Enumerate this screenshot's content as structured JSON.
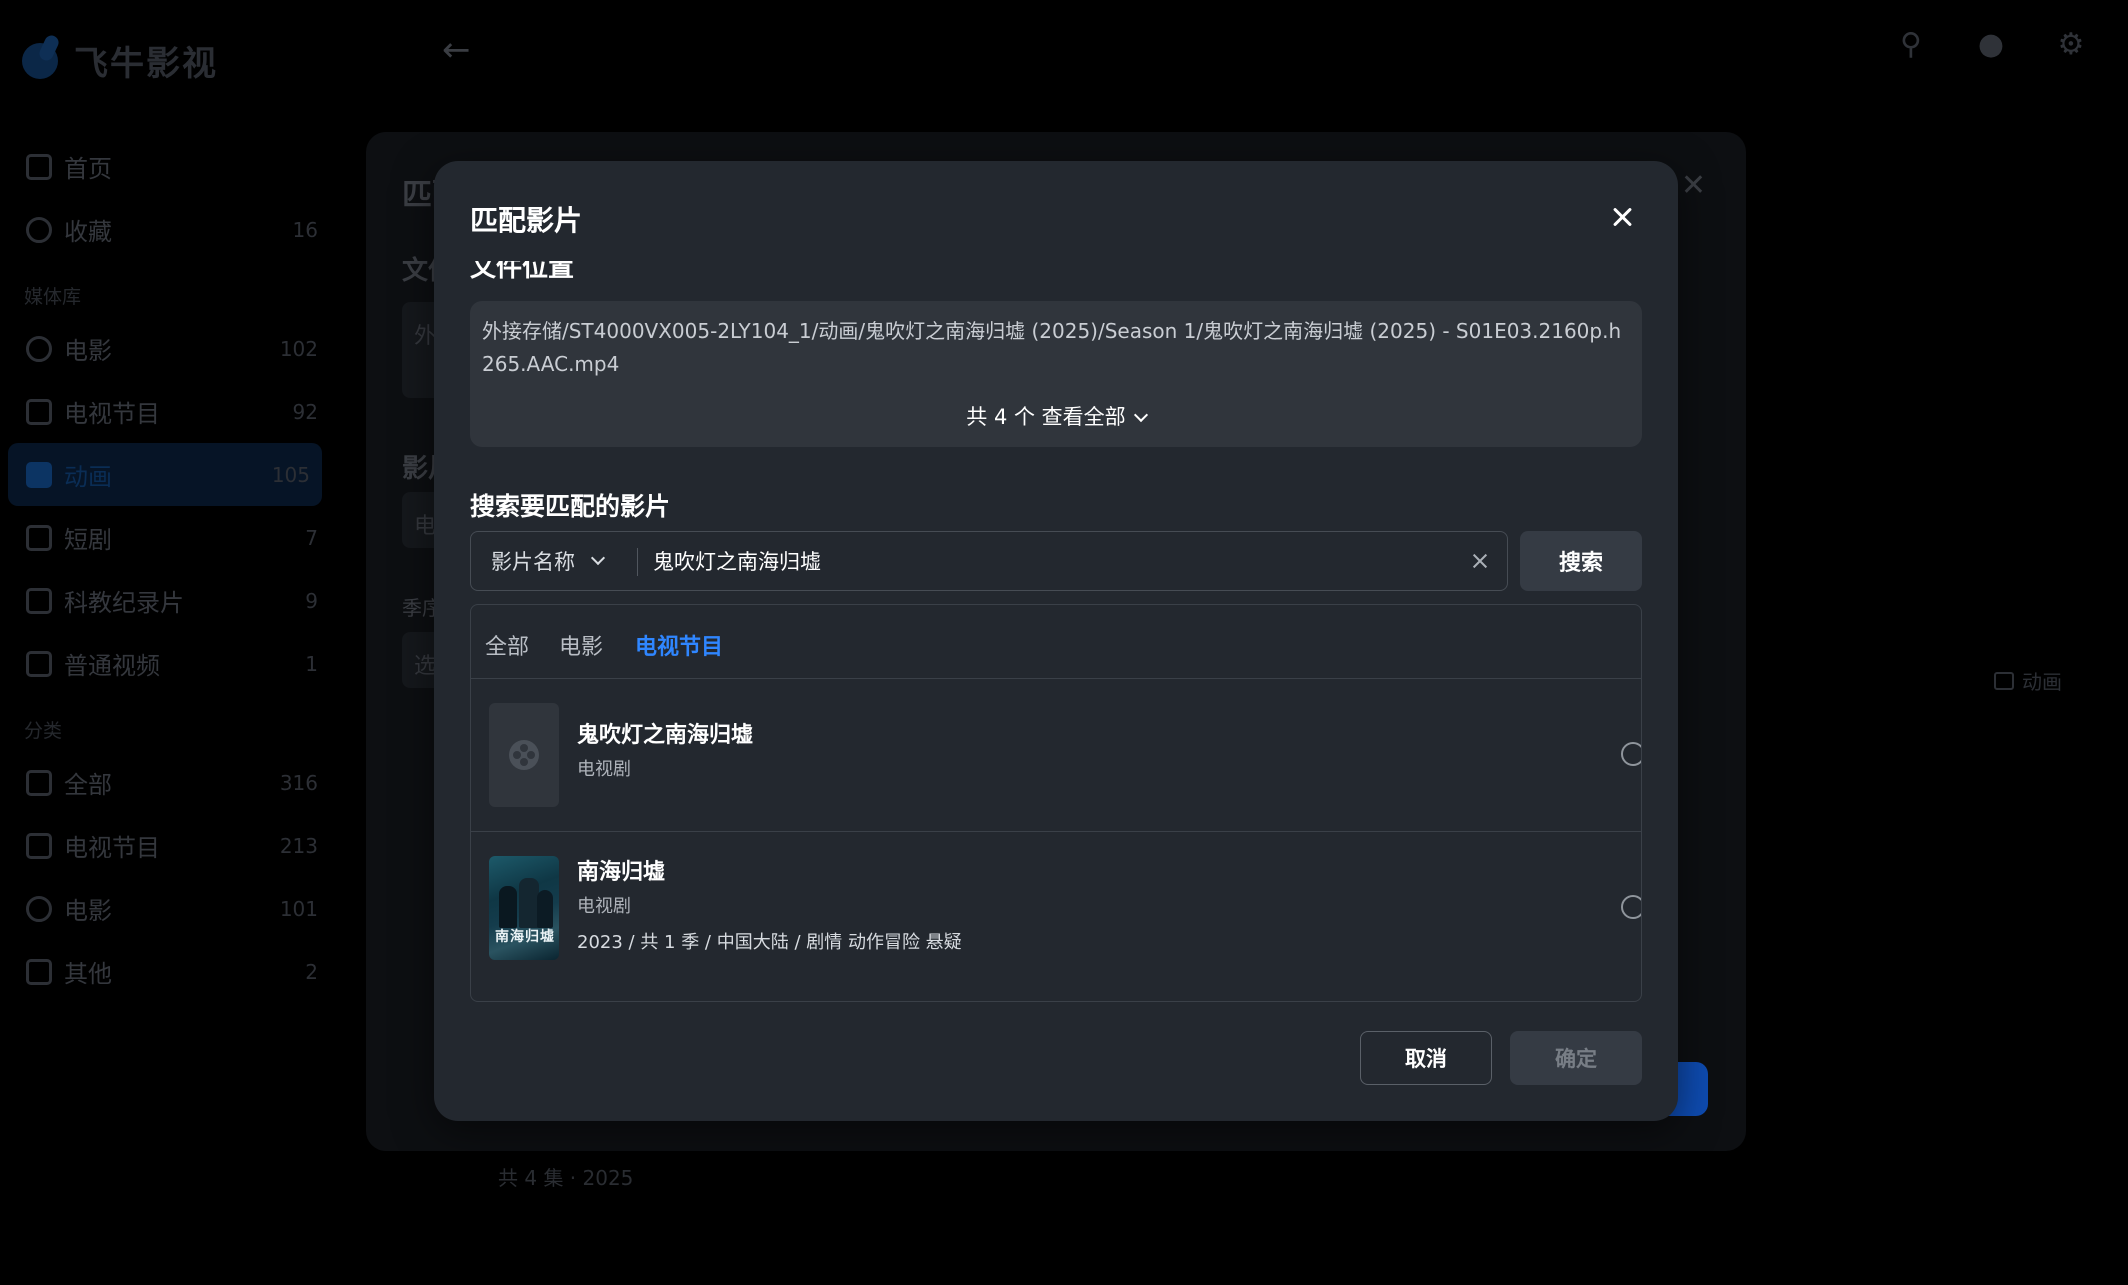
{
  "app": {
    "brand_name": "飞牛影视"
  },
  "sidebar": {
    "items": [
      {
        "label": "首页",
        "count": ""
      },
      {
        "label": "收藏",
        "count": "16"
      }
    ],
    "library_section": "媒体库",
    "library": [
      {
        "label": "电影",
        "count": "102"
      },
      {
        "label": "电视节目",
        "count": "92"
      },
      {
        "label": "动画",
        "count": "105"
      },
      {
        "label": "短剧",
        "count": "7"
      },
      {
        "label": "科教纪录片",
        "count": "9"
      },
      {
        "label": "普通视频",
        "count": "1"
      }
    ],
    "category_section": "分类",
    "categories": [
      {
        "label": "全部",
        "count": "316"
      },
      {
        "label": "电视节目",
        "count": "213"
      },
      {
        "label": "电影",
        "count": "101"
      },
      {
        "label": "其他",
        "count": "2"
      }
    ]
  },
  "back_dialog": {
    "title": "匹配",
    "label_file": "文件",
    "label_film": "影片",
    "label_season": "季序",
    "field_file": "外",
    "field_film": "电",
    "field_season": "选",
    "right_tag": "动画",
    "bottom_text": "共 4 集 · 2025"
  },
  "modal": {
    "title": "匹配影片",
    "file_location_label": "文件位置",
    "file_path": "外接存储/ST4000VX005-2LY104_1/动画/鬼吹灯之南海归墟 (2025)/Season 1/鬼吹灯之南海归墟 (2025) - S01E03.2160p.h265.AAC.mp4",
    "file_more": "共 4 个 查看全部",
    "search_title": "搜索要匹配的影片",
    "search_type": "影片名称",
    "search_value": "鬼吹灯之南海归墟",
    "search_button": "搜索",
    "tabs": [
      {
        "label": "全部"
      },
      {
        "label": "电影"
      },
      {
        "label": "电视节目"
      }
    ],
    "results": [
      {
        "title": "鬼吹灯之南海归墟",
        "type": "电视剧",
        "meta": ""
      },
      {
        "title": "南海归墟",
        "type": "电视剧",
        "meta": "2023 / 共 1 季 / 中国大陆 / 剧情 动作冒险 悬疑",
        "poster_text": "南海归墟"
      }
    ],
    "cancel_label": "取消",
    "confirm_label": "确定"
  },
  "colors": {
    "accent": "#2f86ff",
    "modal_bg": "#23282f"
  },
  "icons": {
    "back": "arrow-left-icon",
    "search": "search-icon",
    "user": "user-icon",
    "settings": "gear-icon"
  }
}
